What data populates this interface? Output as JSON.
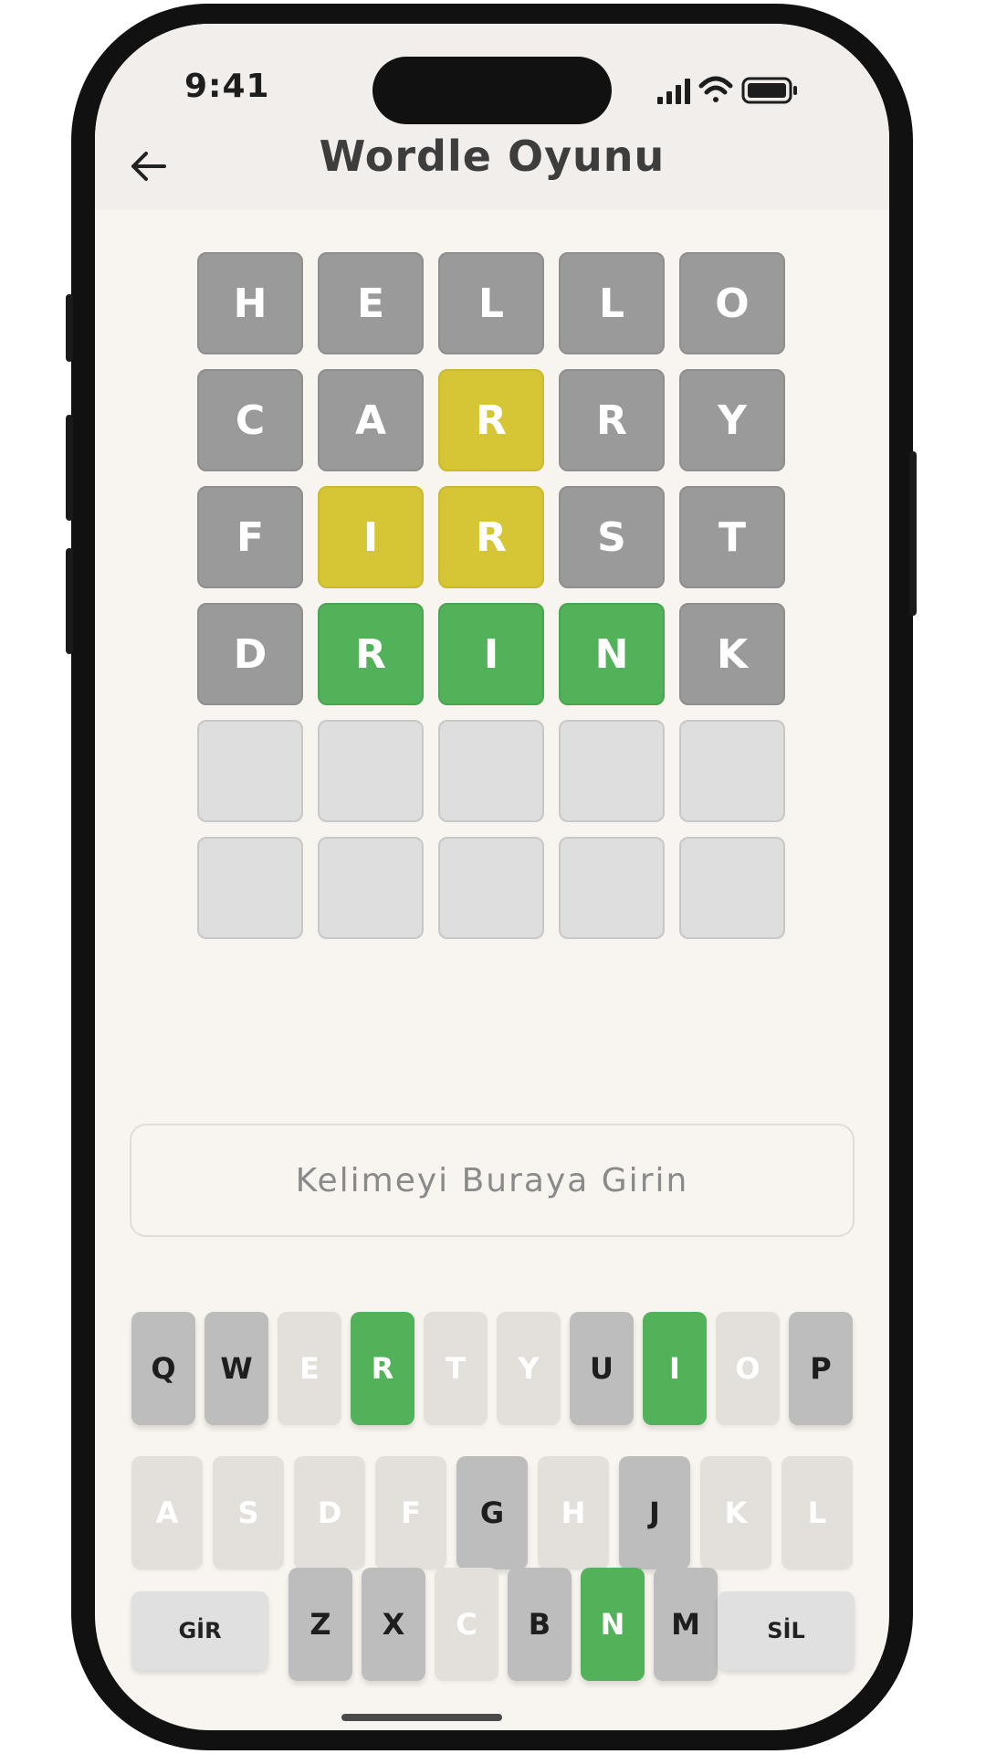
{
  "status_bar": {
    "time": "9:41"
  },
  "header": {
    "title": "Wordle Oyunu"
  },
  "board": {
    "rows": [
      [
        {
          "l": "H",
          "s": "gray"
        },
        {
          "l": "E",
          "s": "gray"
        },
        {
          "l": "L",
          "s": "gray"
        },
        {
          "l": "L",
          "s": "gray"
        },
        {
          "l": "O",
          "s": "gray"
        }
      ],
      [
        {
          "l": "C",
          "s": "gray"
        },
        {
          "l": "A",
          "s": "gray"
        },
        {
          "l": "R",
          "s": "yellow"
        },
        {
          "l": "R",
          "s": "gray"
        },
        {
          "l": "Y",
          "s": "gray"
        }
      ],
      [
        {
          "l": "F",
          "s": "gray"
        },
        {
          "l": "I",
          "s": "yellow"
        },
        {
          "l": "R",
          "s": "yellow"
        },
        {
          "l": "S",
          "s": "gray"
        },
        {
          "l": "T",
          "s": "gray"
        }
      ],
      [
        {
          "l": "D",
          "s": "gray"
        },
        {
          "l": "R",
          "s": "green"
        },
        {
          "l": "I",
          "s": "green"
        },
        {
          "l": "N",
          "s": "green"
        },
        {
          "l": "K",
          "s": "gray"
        }
      ],
      [
        {
          "l": "",
          "s": "empty"
        },
        {
          "l": "",
          "s": "empty"
        },
        {
          "l": "",
          "s": "empty"
        },
        {
          "l": "",
          "s": "empty"
        },
        {
          "l": "",
          "s": "empty"
        }
      ],
      [
        {
          "l": "",
          "s": "empty"
        },
        {
          "l": "",
          "s": "empty"
        },
        {
          "l": "",
          "s": "empty"
        },
        {
          "l": "",
          "s": "empty"
        },
        {
          "l": "",
          "s": "empty"
        }
      ]
    ]
  },
  "input": {
    "placeholder": "Kelimeyi Buraya Girin",
    "value": ""
  },
  "keyboard": {
    "row1": [
      {
        "k": "Q",
        "s": "used"
      },
      {
        "k": "W",
        "s": "used"
      },
      {
        "k": "E",
        "s": "unused"
      },
      {
        "k": "R",
        "s": "hit"
      },
      {
        "k": "T",
        "s": "unused"
      },
      {
        "k": "Y",
        "s": "unused"
      },
      {
        "k": "U",
        "s": "used"
      },
      {
        "k": "I",
        "s": "hit"
      },
      {
        "k": "O",
        "s": "unused"
      },
      {
        "k": "P",
        "s": "used"
      }
    ],
    "row2": [
      {
        "k": "A",
        "s": "unused"
      },
      {
        "k": "S",
        "s": "unused"
      },
      {
        "k": "D",
        "s": "unused"
      },
      {
        "k": "F",
        "s": "unused"
      },
      {
        "k": "G",
        "s": "used"
      },
      {
        "k": "H",
        "s": "unused"
      },
      {
        "k": "J",
        "s": "used"
      },
      {
        "k": "K",
        "s": "unused"
      },
      {
        "k": "L",
        "s": "unused"
      }
    ],
    "row3": [
      {
        "k": "GİR",
        "s": "action"
      },
      {
        "k": "Z",
        "s": "used"
      },
      {
        "k": "X",
        "s": "used"
      },
      {
        "k": "C",
        "s": "unused"
      },
      {
        "k": "B",
        "s": "used"
      },
      {
        "k": "N",
        "s": "hit"
      },
      {
        "k": "M",
        "s": "used"
      },
      {
        "k": "SİL",
        "s": "action"
      }
    ]
  },
  "colors": {
    "gray": "#9a9a9a",
    "yellow": "#d6c535",
    "green": "#52b25a",
    "empty": "#dedede"
  }
}
